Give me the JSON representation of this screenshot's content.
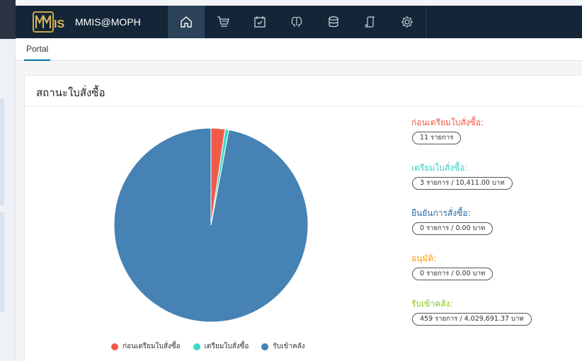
{
  "app": {
    "brand": "MMIS@MOPH",
    "logo_text": "MMIS"
  },
  "nav": {
    "icons": [
      "home-icon",
      "cart-icon",
      "calendar-check-icon",
      "brain-icon",
      "database-icon",
      "scroll-icon",
      "gear-icon"
    ],
    "active": "home-icon"
  },
  "subnav": {
    "tab": "Portal"
  },
  "card": {
    "title": "สถานะใบสั่งซื้อ"
  },
  "colors": {
    "header": "#132536",
    "pre_prepare": "#f05a49",
    "prepare": "#3ddbc6",
    "confirm": "#2a6aa0",
    "approve": "#f59b11",
    "received": "#8cc215",
    "pie_blue": "#4682b4"
  },
  "stats": [
    {
      "label": "ก่อนเตรียมใบสั่งซื้อ:",
      "value": "11 รายการ",
      "color": "#f05a49"
    },
    {
      "label": "เตรียมใบสั่งซื้อ:",
      "value": "3 รายการ / 10,411.00 บาท",
      "color": "#3bcfc0"
    },
    {
      "label": "ยืนยันการสั่งซื้อ:",
      "value": "0 รายการ / 0.00 บาท",
      "color": "#2a6aa0"
    },
    {
      "label": "อนุมัติ:",
      "value": "0 รายการ / 0.00 บาท",
      "color": "#f59b11"
    },
    {
      "label": "รับเข้าคลัง:",
      "value": "459 รายการ / 4,029,691.37 บาท",
      "color": "#8cc215"
    }
  ],
  "chart_data": {
    "type": "pie",
    "categories": [
      "ก่อนเตรียมใบสั่งซื้อ",
      "เตรียมใบสั่งซื้อ",
      "รับเข้าคลัง"
    ],
    "values": [
      11,
      3,
      459
    ],
    "colors": [
      "#f05a49",
      "#3ddbc6",
      "#4682b4"
    ],
    "title": "",
    "legend": "bottom"
  }
}
